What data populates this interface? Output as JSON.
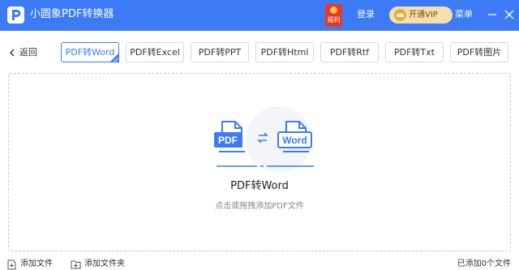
{
  "app": {
    "title": "小圆象PDF转换器"
  },
  "header": {
    "gift_label": "福利",
    "login_label": "登录",
    "vip_label": "开通VIP",
    "menu_label": "菜单",
    "accent_color": "#3d7bf6"
  },
  "toolbar": {
    "back_label": "返回",
    "tabs": [
      {
        "label": "PDF转Word",
        "active": true
      },
      {
        "label": "PDF转Excel"
      },
      {
        "label": "PDF转PPT"
      },
      {
        "label": "PDF转Html"
      },
      {
        "label": "PDF转Rtf"
      },
      {
        "label": "PDF转Txt"
      },
      {
        "label": "PDF转图片"
      }
    ]
  },
  "dropzone": {
    "title": "PDF转Word",
    "hint": "点击或拖拽添加PDF文件",
    "source_badge": "PDF",
    "target_badge": "Word"
  },
  "footer": {
    "add_file_label": "添加文件",
    "add_folder_label": "添加文件夹",
    "count_label": "已添加0个文件"
  }
}
